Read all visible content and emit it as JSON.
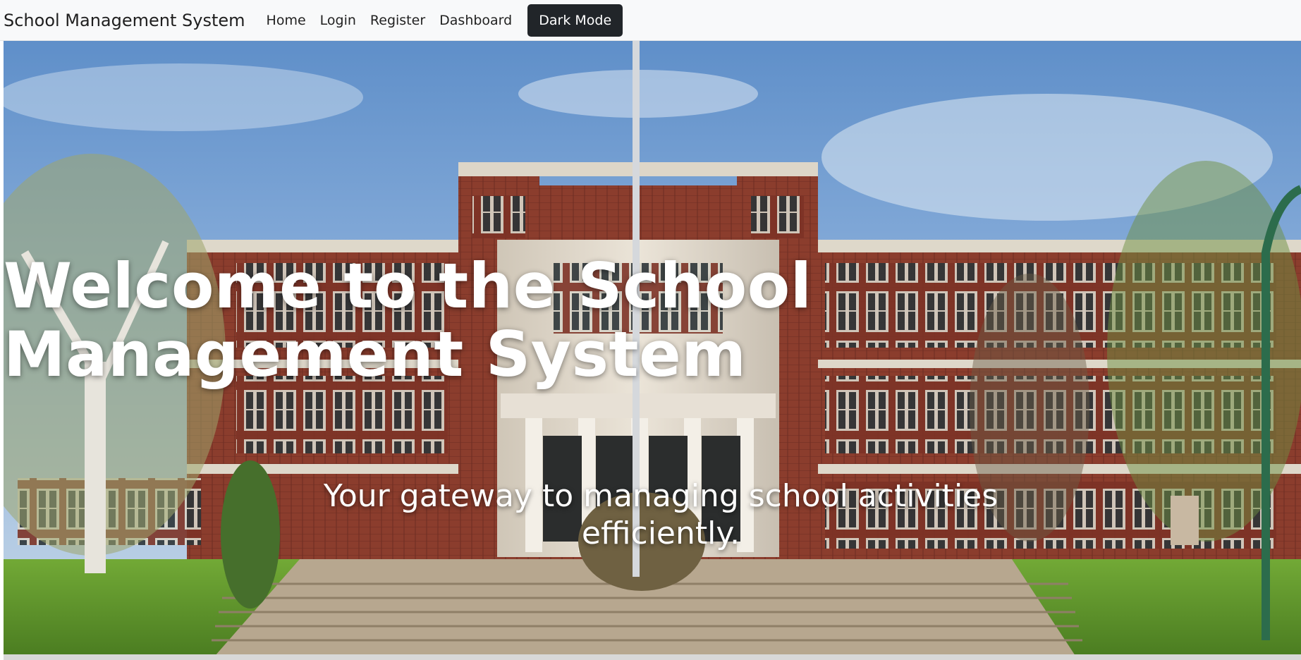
{
  "app": {
    "brand": "School Management System"
  },
  "navigation": {
    "items": [
      {
        "label": "Home"
      },
      {
        "label": "Login"
      },
      {
        "label": "Register"
      },
      {
        "label": "Dashboard"
      }
    ],
    "dark_mode_button": "Dark Mode"
  },
  "hero": {
    "title": "Welcome to the School Management System",
    "subtitle": "Your gateway to managing school activities efficiently."
  },
  "colors": {
    "navbar_background": "#f8f9fa",
    "dark_button": "#212529",
    "hero_text": "#ffffff"
  }
}
